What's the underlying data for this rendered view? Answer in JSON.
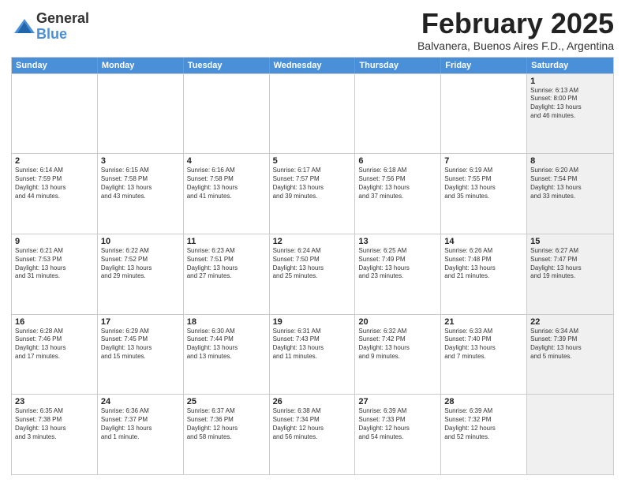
{
  "logo": {
    "general": "General",
    "blue": "Blue"
  },
  "header": {
    "month": "February 2025",
    "location": "Balvanera, Buenos Aires F.D., Argentina"
  },
  "weekdays": [
    "Sunday",
    "Monday",
    "Tuesday",
    "Wednesday",
    "Thursday",
    "Friday",
    "Saturday"
  ],
  "rows": [
    [
      {
        "day": "",
        "info": "",
        "shaded": false
      },
      {
        "day": "",
        "info": "",
        "shaded": false
      },
      {
        "day": "",
        "info": "",
        "shaded": false
      },
      {
        "day": "",
        "info": "",
        "shaded": false
      },
      {
        "day": "",
        "info": "",
        "shaded": false
      },
      {
        "day": "",
        "info": "",
        "shaded": false
      },
      {
        "day": "1",
        "info": "Sunrise: 6:13 AM\nSunset: 8:00 PM\nDaylight: 13 hours\nand 46 minutes.",
        "shaded": true
      }
    ],
    [
      {
        "day": "2",
        "info": "Sunrise: 6:14 AM\nSunset: 7:59 PM\nDaylight: 13 hours\nand 44 minutes.",
        "shaded": false
      },
      {
        "day": "3",
        "info": "Sunrise: 6:15 AM\nSunset: 7:58 PM\nDaylight: 13 hours\nand 43 minutes.",
        "shaded": false
      },
      {
        "day": "4",
        "info": "Sunrise: 6:16 AM\nSunset: 7:58 PM\nDaylight: 13 hours\nand 41 minutes.",
        "shaded": false
      },
      {
        "day": "5",
        "info": "Sunrise: 6:17 AM\nSunset: 7:57 PM\nDaylight: 13 hours\nand 39 minutes.",
        "shaded": false
      },
      {
        "day": "6",
        "info": "Sunrise: 6:18 AM\nSunset: 7:56 PM\nDaylight: 13 hours\nand 37 minutes.",
        "shaded": false
      },
      {
        "day": "7",
        "info": "Sunrise: 6:19 AM\nSunset: 7:55 PM\nDaylight: 13 hours\nand 35 minutes.",
        "shaded": false
      },
      {
        "day": "8",
        "info": "Sunrise: 6:20 AM\nSunset: 7:54 PM\nDaylight: 13 hours\nand 33 minutes.",
        "shaded": true
      }
    ],
    [
      {
        "day": "9",
        "info": "Sunrise: 6:21 AM\nSunset: 7:53 PM\nDaylight: 13 hours\nand 31 minutes.",
        "shaded": false
      },
      {
        "day": "10",
        "info": "Sunrise: 6:22 AM\nSunset: 7:52 PM\nDaylight: 13 hours\nand 29 minutes.",
        "shaded": false
      },
      {
        "day": "11",
        "info": "Sunrise: 6:23 AM\nSunset: 7:51 PM\nDaylight: 13 hours\nand 27 minutes.",
        "shaded": false
      },
      {
        "day": "12",
        "info": "Sunrise: 6:24 AM\nSunset: 7:50 PM\nDaylight: 13 hours\nand 25 minutes.",
        "shaded": false
      },
      {
        "day": "13",
        "info": "Sunrise: 6:25 AM\nSunset: 7:49 PM\nDaylight: 13 hours\nand 23 minutes.",
        "shaded": false
      },
      {
        "day": "14",
        "info": "Sunrise: 6:26 AM\nSunset: 7:48 PM\nDaylight: 13 hours\nand 21 minutes.",
        "shaded": false
      },
      {
        "day": "15",
        "info": "Sunrise: 6:27 AM\nSunset: 7:47 PM\nDaylight: 13 hours\nand 19 minutes.",
        "shaded": true
      }
    ],
    [
      {
        "day": "16",
        "info": "Sunrise: 6:28 AM\nSunset: 7:46 PM\nDaylight: 13 hours\nand 17 minutes.",
        "shaded": false
      },
      {
        "day": "17",
        "info": "Sunrise: 6:29 AM\nSunset: 7:45 PM\nDaylight: 13 hours\nand 15 minutes.",
        "shaded": false
      },
      {
        "day": "18",
        "info": "Sunrise: 6:30 AM\nSunset: 7:44 PM\nDaylight: 13 hours\nand 13 minutes.",
        "shaded": false
      },
      {
        "day": "19",
        "info": "Sunrise: 6:31 AM\nSunset: 7:43 PM\nDaylight: 13 hours\nand 11 minutes.",
        "shaded": false
      },
      {
        "day": "20",
        "info": "Sunrise: 6:32 AM\nSunset: 7:42 PM\nDaylight: 13 hours\nand 9 minutes.",
        "shaded": false
      },
      {
        "day": "21",
        "info": "Sunrise: 6:33 AM\nSunset: 7:40 PM\nDaylight: 13 hours\nand 7 minutes.",
        "shaded": false
      },
      {
        "day": "22",
        "info": "Sunrise: 6:34 AM\nSunset: 7:39 PM\nDaylight: 13 hours\nand 5 minutes.",
        "shaded": true
      }
    ],
    [
      {
        "day": "23",
        "info": "Sunrise: 6:35 AM\nSunset: 7:38 PM\nDaylight: 13 hours\nand 3 minutes.",
        "shaded": false
      },
      {
        "day": "24",
        "info": "Sunrise: 6:36 AM\nSunset: 7:37 PM\nDaylight: 13 hours\nand 1 minute.",
        "shaded": false
      },
      {
        "day": "25",
        "info": "Sunrise: 6:37 AM\nSunset: 7:36 PM\nDaylight: 12 hours\nand 58 minutes.",
        "shaded": false
      },
      {
        "day": "26",
        "info": "Sunrise: 6:38 AM\nSunset: 7:34 PM\nDaylight: 12 hours\nand 56 minutes.",
        "shaded": false
      },
      {
        "day": "27",
        "info": "Sunrise: 6:39 AM\nSunset: 7:33 PM\nDaylight: 12 hours\nand 54 minutes.",
        "shaded": false
      },
      {
        "day": "28",
        "info": "Sunrise: 6:39 AM\nSunset: 7:32 PM\nDaylight: 12 hours\nand 52 minutes.",
        "shaded": false
      },
      {
        "day": "",
        "info": "",
        "shaded": true
      }
    ]
  ]
}
